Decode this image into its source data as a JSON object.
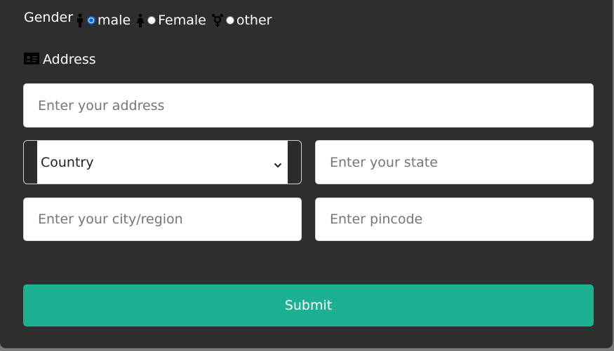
{
  "form": {
    "gender": {
      "label": "Gender",
      "options": [
        {
          "label": "male",
          "icon": "male-icon",
          "checked": true
        },
        {
          "label": "Female",
          "icon": "female-icon",
          "checked": false
        },
        {
          "label": "other",
          "icon": "transgender-icon",
          "checked": false
        }
      ]
    },
    "address": {
      "heading": "Address",
      "icon": "id-card-icon",
      "address_placeholder": "Enter your address",
      "country_selected": "Country",
      "state_placeholder": "Enter your state",
      "city_placeholder": "Enter your city/region",
      "pincode_placeholder": "Enter pincode"
    },
    "submit_label": "Submit"
  },
  "colors": {
    "background": "#2e2e2e",
    "submit": "#1bb192",
    "radio_accent": "#0a66d8"
  }
}
